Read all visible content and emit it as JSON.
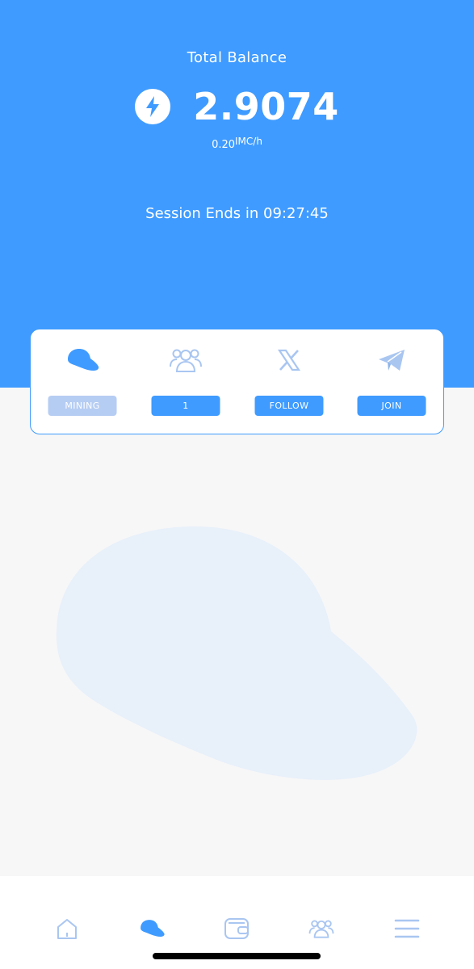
{
  "balance": {
    "label": "Total Balance",
    "value": "2.9074",
    "rate_value": "0.20",
    "rate_unit": "IMC/h"
  },
  "session": {
    "text": "Session Ends in 09:27:45"
  },
  "actions": [
    {
      "icon": "cap-icon",
      "label": "MINING",
      "state": "disabled"
    },
    {
      "icon": "users-icon",
      "label": "1",
      "state": "active"
    },
    {
      "icon": "x-logo-icon",
      "label": "FOLLOW",
      "state": "active"
    },
    {
      "icon": "telegram-icon",
      "label": "JOIN",
      "state": "active"
    }
  ],
  "bottom_nav": [
    {
      "icon": "home-icon",
      "selected": false
    },
    {
      "icon": "cap-icon",
      "selected": true
    },
    {
      "icon": "wallet-icon",
      "selected": false
    },
    {
      "icon": "users-icon",
      "selected": false
    },
    {
      "icon": "menu-icon",
      "selected": false
    }
  ],
  "colors": {
    "primary": "#3f9bff",
    "disabled": "#b6cdf3",
    "icon_light": "#a9c6f1",
    "background": "#f7f7f7"
  }
}
